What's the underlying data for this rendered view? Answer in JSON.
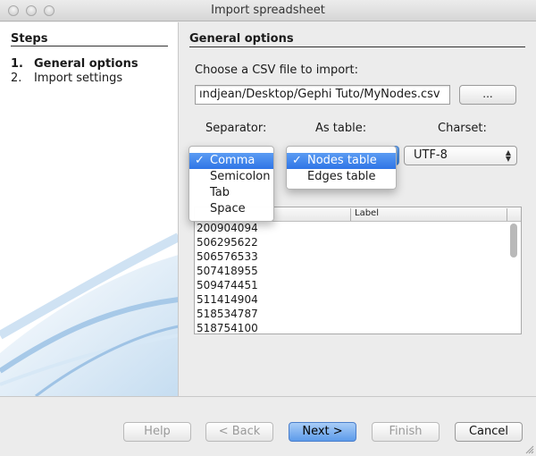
{
  "window": {
    "title": "Import spreadsheet"
  },
  "steps": {
    "heading": "Steps",
    "items": [
      {
        "num": "1.",
        "label": "General options"
      },
      {
        "num": "2.",
        "label": "Import settings"
      }
    ]
  },
  "main": {
    "heading": "General options",
    "choose_label": "Choose a CSV file to import:",
    "file_path": "ındjean/Desktop/Gephi Tuto/MyNodes.csv",
    "browse_label": "...",
    "separator_label": "Separator:",
    "as_table_label": "As table:",
    "charset_label": "Charset:",
    "charset_value": "UTF-8",
    "separator_menu": {
      "check": "✓",
      "items": [
        "Comma",
        "Semicolon",
        "Tab",
        "Space"
      ],
      "selected": "Comma"
    },
    "table_menu": {
      "check": "✓",
      "items": [
        "Nodes table",
        "Edges table"
      ],
      "selected": "Nodes table"
    },
    "table": {
      "columns": [
        "",
        "Label"
      ],
      "rows": [
        "200904094",
        "506295622",
        "506576533",
        "507418955",
        "509474451",
        "511414904",
        "518534787",
        "518754100"
      ]
    }
  },
  "footer": {
    "help": "Help",
    "back": "< Back",
    "next": "Next >",
    "finish": "Finish",
    "cancel": "Cancel"
  }
}
